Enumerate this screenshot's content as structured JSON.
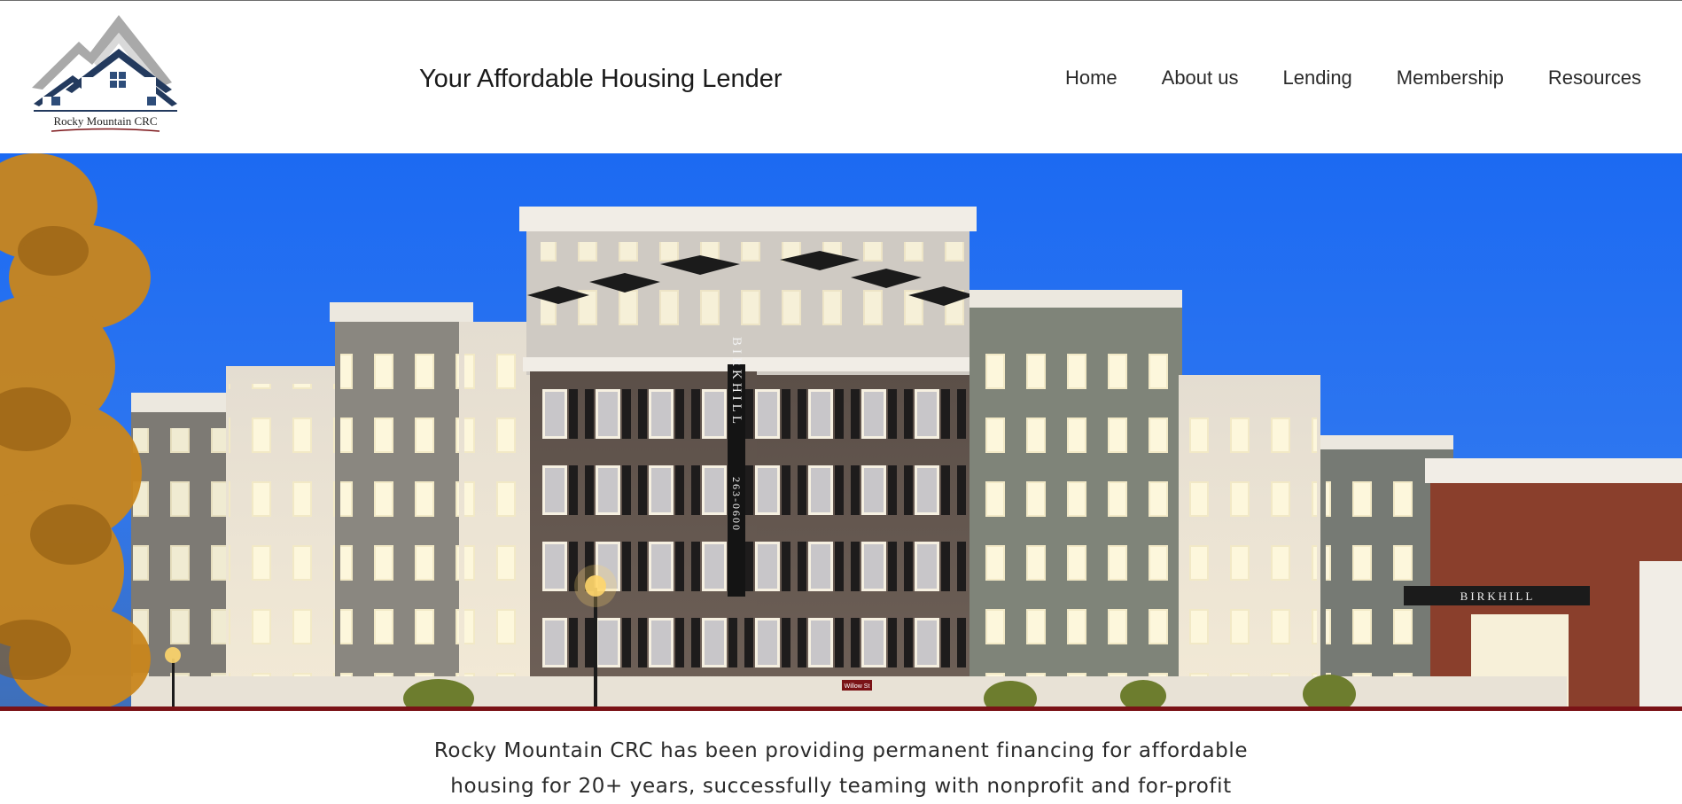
{
  "brand": {
    "logo_text": "Rocky Mountain CRC",
    "logo_icon": "mountain-house-icon",
    "tagline": "Your Affordable Housing Lender"
  },
  "nav": {
    "items": [
      {
        "label": "Home"
      },
      {
        "label": "About us"
      },
      {
        "label": "Lending"
      },
      {
        "label": "Membership"
      },
      {
        "label": "Resources"
      }
    ]
  },
  "hero": {
    "building_sign_vertical": "BIRKHILL",
    "building_number": "263-0600",
    "storefront_sign": "BIRKHILL",
    "street_sign": "Willow St",
    "colors": {
      "sky": "#1f6ff0",
      "accent_stripe": "#7a1216"
    }
  },
  "intro": {
    "line1": "Rocky Mountain CRC has been providing permanent financing for affordable",
    "line2": "housing for 20+ years, successfully teaming with nonprofit and for-profit"
  }
}
